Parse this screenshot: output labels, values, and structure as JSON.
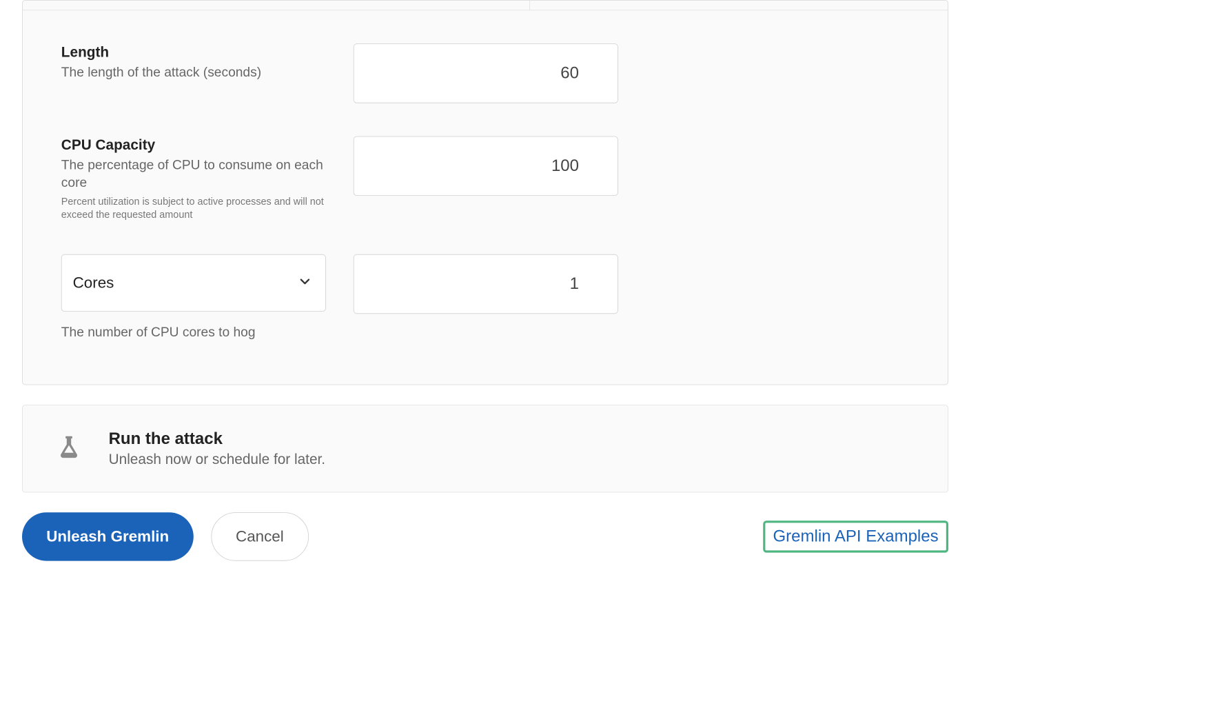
{
  "fields": {
    "length": {
      "title": "Length",
      "desc": "The length of the attack (seconds)",
      "value": "60"
    },
    "cpu": {
      "title": "CPU Capacity",
      "desc": "The percentage of CPU to consume on each core",
      "note": "Percent utilization is subject to active processes and will not exceed the requested amount",
      "value": "100"
    },
    "cores": {
      "selected": "Cores",
      "desc": "The number of CPU cores to hog",
      "value": "1"
    }
  },
  "run": {
    "title": "Run the attack",
    "desc": "Unleash now or schedule for later."
  },
  "footer": {
    "primary": "Unleash Gremlin",
    "secondary": "Cancel",
    "api_link": "Gremlin API Examples"
  }
}
